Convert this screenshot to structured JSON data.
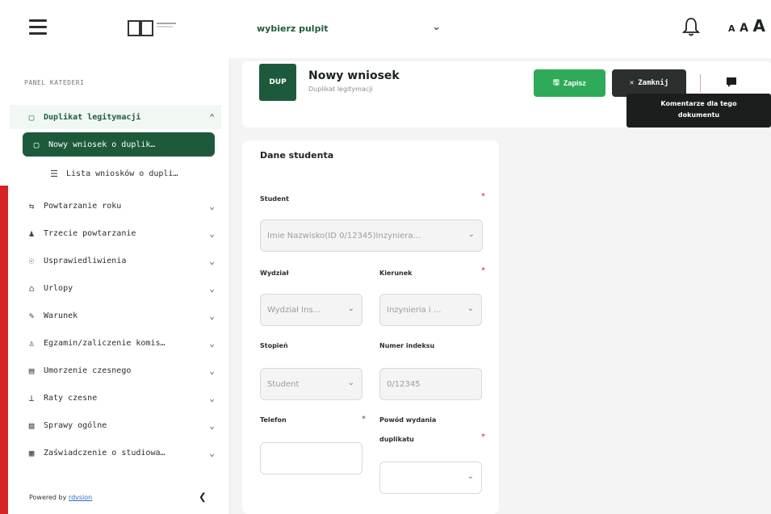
{
  "topbar": {
    "dashboard_select": "wybierz pulpit",
    "font_size_labels": [
      "A",
      "A",
      "A"
    ]
  },
  "sidebar": {
    "section_header": "PANEL KATEDERI",
    "groups": [
      {
        "label": "Duplikat legitymacji",
        "icon": "card-icon",
        "expanded": true
      }
    ],
    "subitems": [
      {
        "label": "Nowy wniosek o duplik…",
        "icon": "card-icon",
        "active": true
      },
      {
        "label": "Lista wniosków o dupli…",
        "icon": "list-icon",
        "active": false
      }
    ],
    "items": [
      {
        "label": "Powtarzanie roku",
        "icon": "repeat-icon"
      },
      {
        "label": "Trzecie powtarzanie",
        "icon": "people-icon"
      },
      {
        "label": "Usprawiedliwienia",
        "icon": "shield-icon"
      },
      {
        "label": "Urlopy",
        "icon": "home-icon"
      },
      {
        "label": "Warunek",
        "icon": "edit-icon"
      },
      {
        "label": "Egzamin/zaliczenie komis…",
        "icon": "person-icon"
      },
      {
        "label": "Umorzenie czesnego",
        "icon": "document-icon"
      },
      {
        "label": "Raty czesne",
        "icon": "money-icon"
      },
      {
        "label": "Sprawy ogólne",
        "icon": "folder-icon"
      },
      {
        "label": "Zaświadczenie o studiowa…",
        "icon": "certificate-icon"
      }
    ],
    "footer_text": "Powered by ",
    "footer_link": "rdvsion"
  },
  "document": {
    "badge": "DUP",
    "title": "Nowy wniosek",
    "subtitle": "Duplikat legitymacji",
    "save_label": "Zapisz",
    "close_label": "Zamknij",
    "comment_tooltip_line1": "Komentarze dla tego",
    "comment_tooltip_line2": "dokumentu"
  },
  "form": {
    "section_title": "Dane studenta",
    "student_label": "Student",
    "student_value": "Imie Nazwisko(ID 0/12345)Inzyniera...",
    "faculty_label": "Wydział",
    "faculty_value": "Wydział Ins...",
    "major_label": "Kierunek",
    "major_value": "Inzynieria i ...",
    "degree_label": "Stopień",
    "degree_value": "Student",
    "index_label": "Numer indeksu",
    "index_value": "0/12345",
    "phone_label": "Telefon",
    "phone_value": "",
    "reason_label_1": "Powód wydania",
    "reason_label_2": "duplikatu",
    "reason_value": "",
    "required_mark": "*"
  },
  "colors": {
    "brand_green": "#1d5a3c",
    "save_green": "#2faa58",
    "dark": "#2b2f2d",
    "accent_red": "#d42424"
  }
}
